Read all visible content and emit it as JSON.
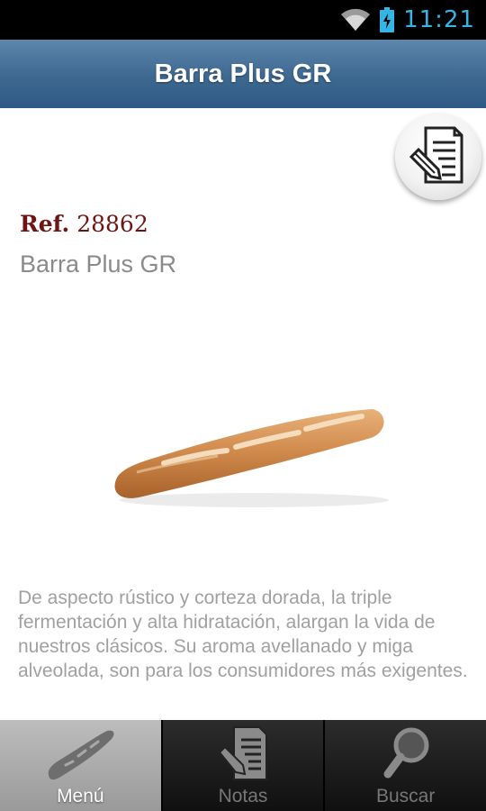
{
  "status_bar": {
    "time": "11:21",
    "icons": [
      "wifi-icon",
      "battery-charging-icon"
    ],
    "accent": "#33b5e5"
  },
  "header": {
    "title": "Barra Plus GR",
    "note_icon": "edit-note-icon"
  },
  "product": {
    "ref_label": "Ref.",
    "ref_number": "28862",
    "name": "Barra Plus GR",
    "image": "baguette-bread-image",
    "description": "De aspecto rústico y corteza dorada, la triple fermentación y alta hidratación, alargan la vida de nuestros clásicos. Su aroma avellanado y miga alveolada, son para los consumidores más exigentes."
  },
  "tabs": [
    {
      "label": "Menú",
      "icon": "bread-icon",
      "active": true
    },
    {
      "label": "Notas",
      "icon": "notes-icon",
      "active": false
    },
    {
      "label": "Buscar",
      "icon": "magnifier-icon",
      "active": false
    }
  ],
  "colors": {
    "title_bar": "#3d6890",
    "ref_text": "#6e1414",
    "name_text": "#8a8a8a"
  }
}
